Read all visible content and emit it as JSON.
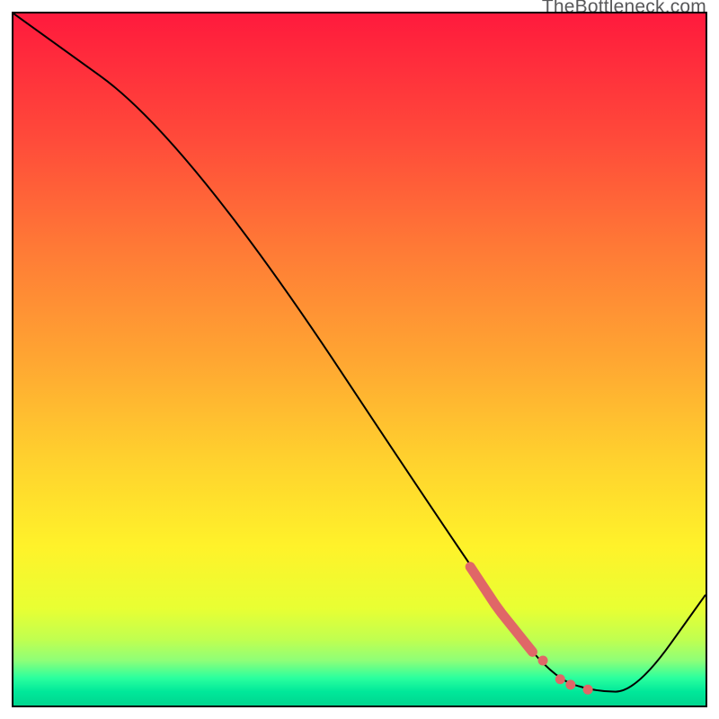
{
  "watermark": "TheBottleneck.com",
  "colors": {
    "gradient_stops": [
      "#ff1a3d",
      "#ff4a3a",
      "#ff7a36",
      "#ffa632",
      "#ffd02e",
      "#fff22a",
      "#e8ff33",
      "#c0ff50",
      "#8eff78",
      "#2bff9e",
      "#00e89a",
      "#00d68f"
    ],
    "curve": "#000000",
    "marker": "#e06767"
  },
  "chart_data": {
    "type": "line",
    "title": "",
    "xlabel": "",
    "ylabel": "",
    "xlim": [
      0,
      100
    ],
    "ylim": [
      0,
      100
    ],
    "grid": false,
    "legend": false,
    "curve_points": [
      {
        "x": 0,
        "y": 100
      },
      {
        "x": 25,
        "y": 82
      },
      {
        "x": 70,
        "y": 14
      },
      {
        "x": 78,
        "y": 4
      },
      {
        "x": 84,
        "y": 2
      },
      {
        "x": 90,
        "y": 2
      },
      {
        "x": 100,
        "y": 16
      }
    ],
    "highlight_segment": {
      "x_start": 66,
      "x_end": 75
    },
    "highlight_markers": [
      {
        "x": 76.5,
        "y": 6.5
      },
      {
        "x": 79,
        "y": 3.8
      },
      {
        "x": 80.5,
        "y": 3.0
      },
      {
        "x": 83,
        "y": 2.3
      }
    ]
  }
}
